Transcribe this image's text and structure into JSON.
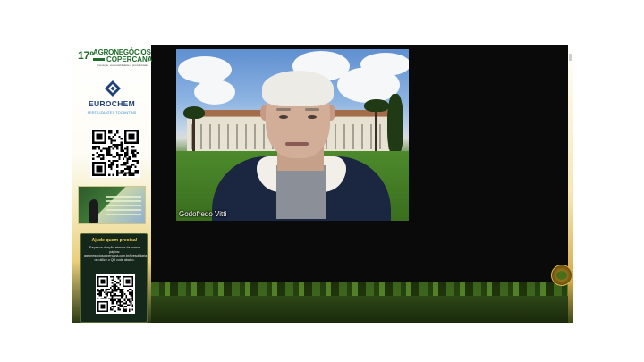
{
  "event": {
    "edition": "17º",
    "line1": "AGRONEGÓCIOS",
    "line2": "COPERCANA",
    "tagline": "Inovação, sustentabilidade e produtividade"
  },
  "sponsor": {
    "name": "EUROCHEM",
    "subtitle": "FERTILIZANTES TOCANTINS",
    "icon": "eurochem-diamond-icon"
  },
  "donation": {
    "title": "Ajude quem precisa!",
    "text": "Faça sua doação através da nossa página: agronegocioscopercana.com.br/livesolidaria ou utilize o QR code abaixo."
  },
  "video": {
    "participant_name": "Godofredo Vitti"
  },
  "colors": {
    "brand_green": "#1e6b2a",
    "sponsor_blue": "#1f3f7a",
    "accent_yellow": "#f2d24a",
    "frame_bg": "#0a0a0a"
  }
}
